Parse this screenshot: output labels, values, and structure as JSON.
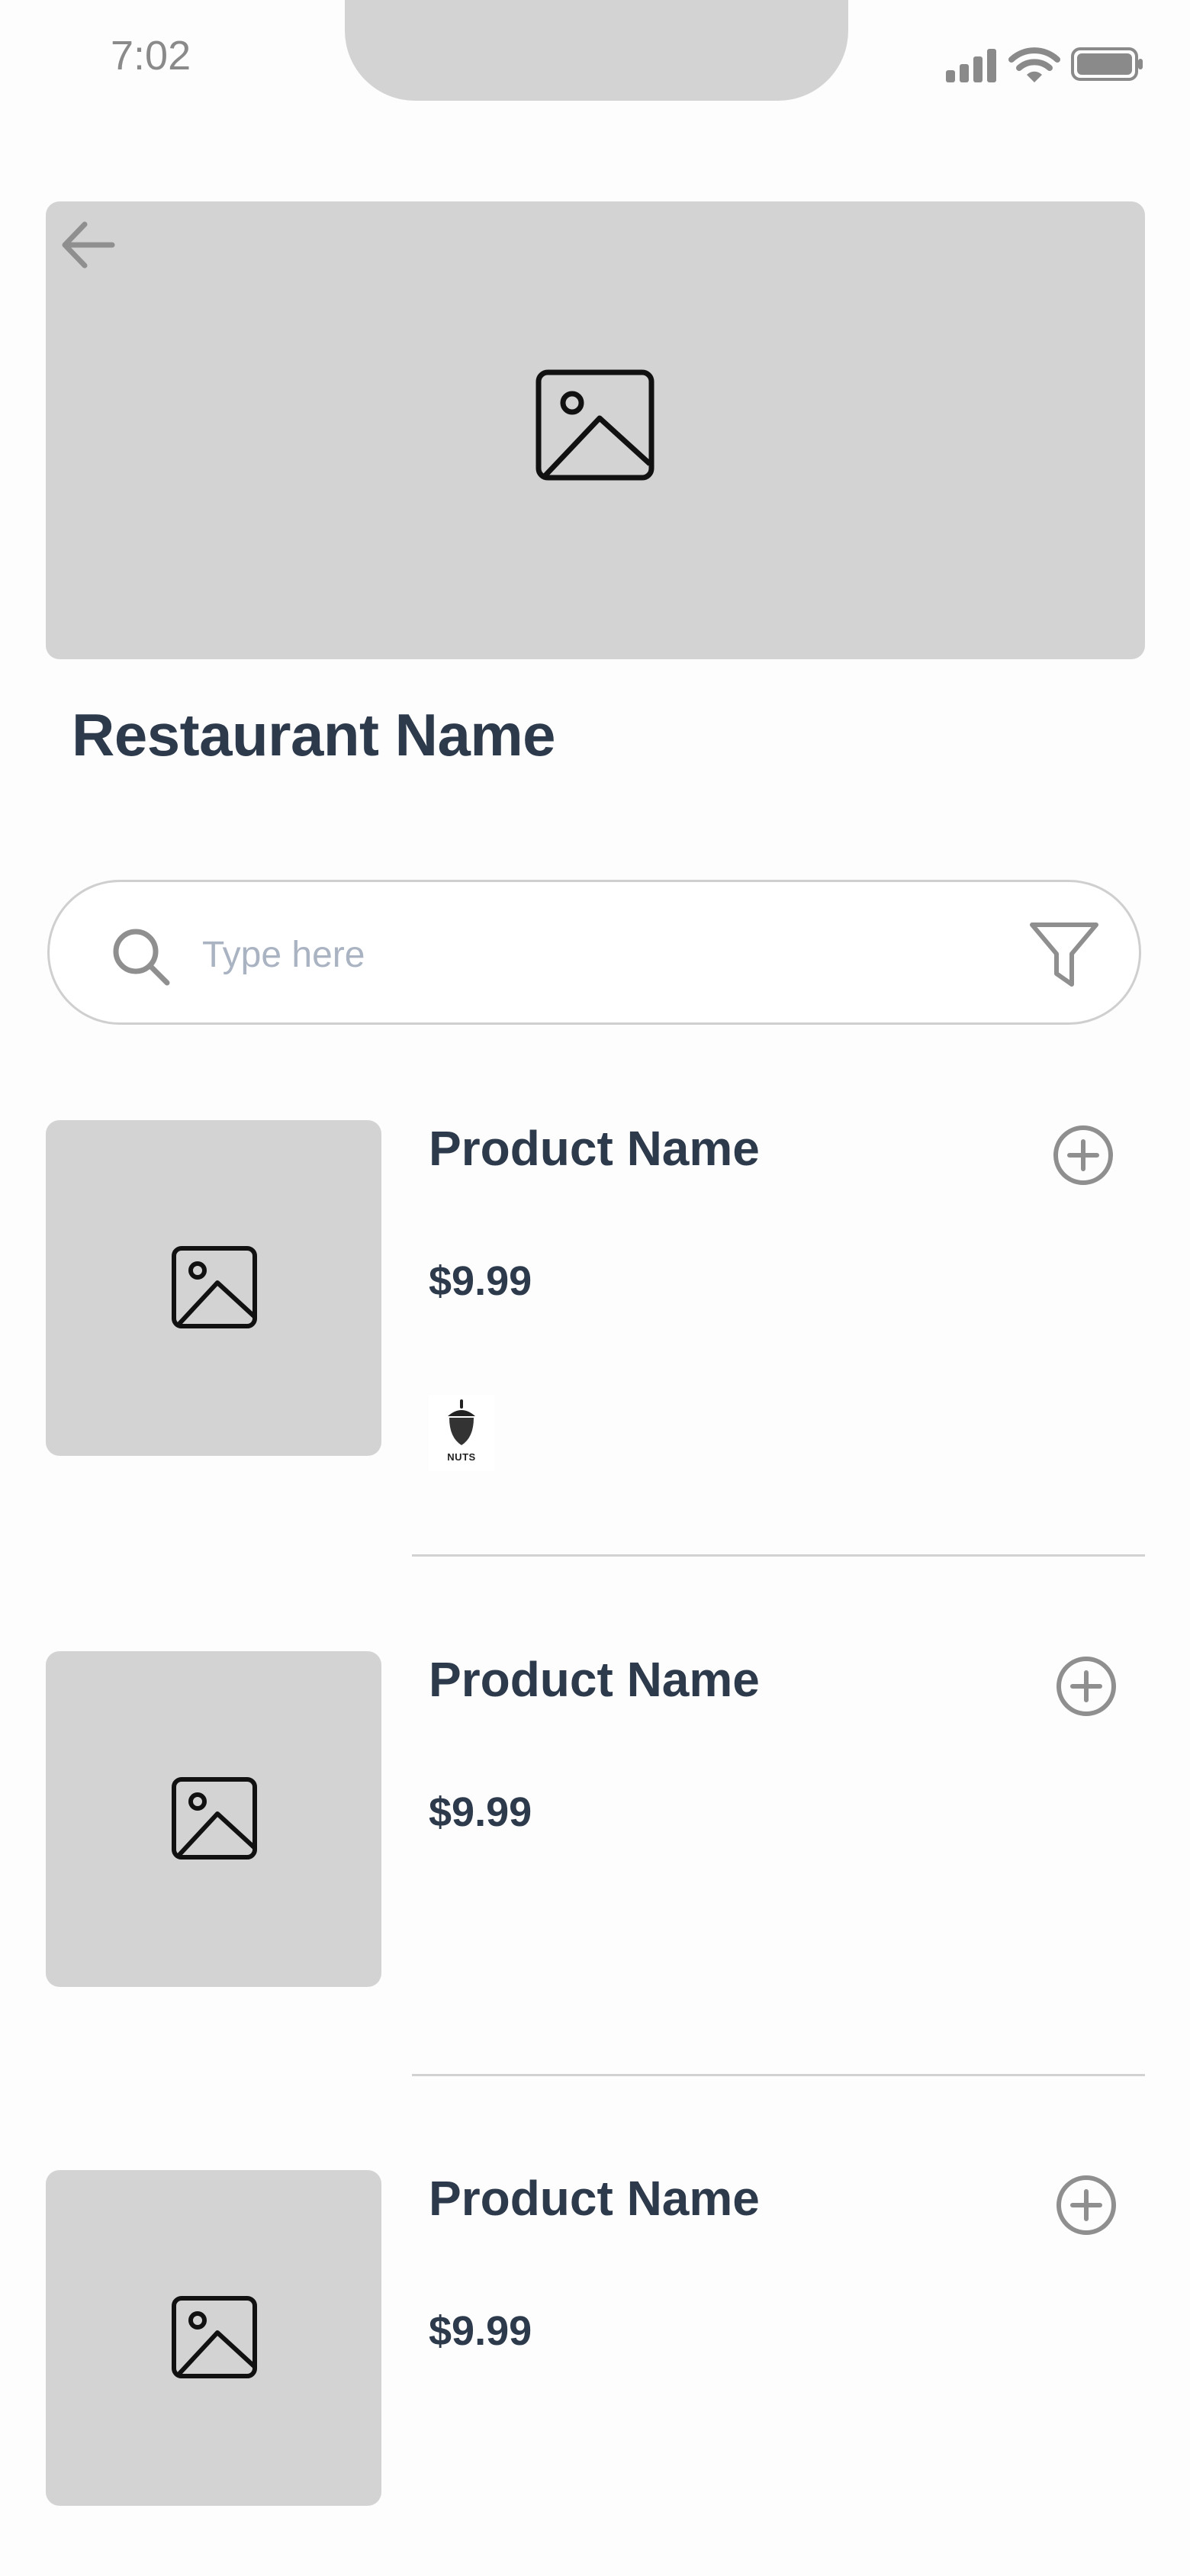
{
  "status_bar": {
    "time": "7:02",
    "icons": [
      "cellular-signal-icon",
      "wifi-icon",
      "battery-icon"
    ]
  },
  "header": {
    "back_icon": "arrow-left-icon",
    "hero_image_icon": "image-placeholder-icon"
  },
  "restaurant": {
    "name": "Restaurant Name"
  },
  "search": {
    "placeholder": "Type here",
    "value": "",
    "search_icon": "search-icon",
    "filter_icon": "filter-icon"
  },
  "products": [
    {
      "name": "Product Name",
      "price": "$9.99",
      "allergens": [
        {
          "icon": "acorn-icon",
          "label": "NUTS"
        }
      ]
    },
    {
      "name": "Product Name",
      "price": "$9.99",
      "allergens": []
    },
    {
      "name": "Product Name",
      "price": "$9.99",
      "allergens": []
    }
  ],
  "colors": {
    "background": "#fdfdfd",
    "placeholder_gray": "#d3d3d3",
    "text_dark": "#2d3a4c",
    "placeholder_text": "#a9b3c2",
    "icon_gray": "#8a8a8a"
  }
}
